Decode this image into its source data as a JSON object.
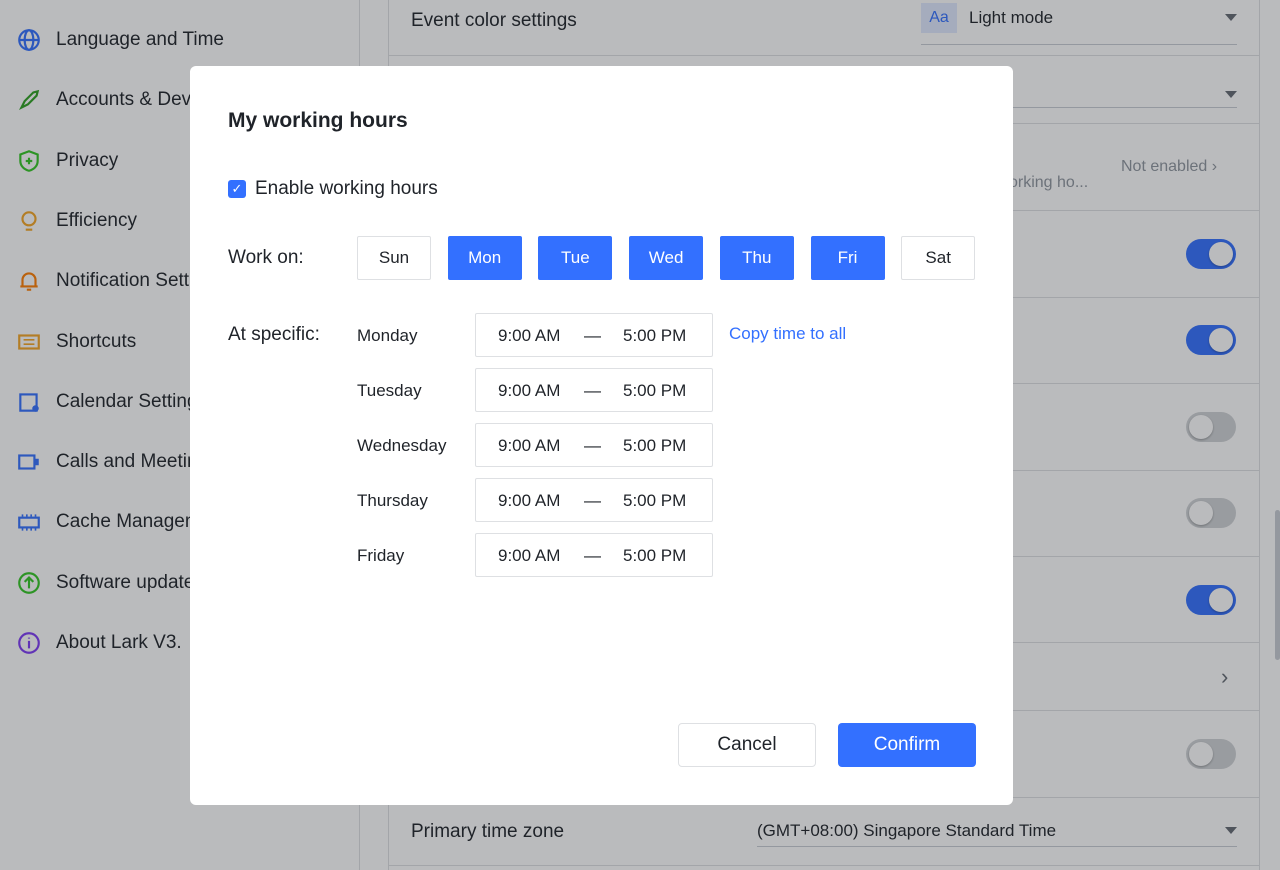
{
  "sidebar": {
    "items": [
      {
        "label": "Language and Time",
        "icon": "globe-icon",
        "color": "#3370ff"
      },
      {
        "label": "Accounts & Devices",
        "icon": "rocket-icon",
        "color": "#2ea121"
      },
      {
        "label": "Privacy",
        "icon": "shield-icon",
        "color": "#34c724"
      },
      {
        "label": "Efficiency",
        "icon": "lightbulb-icon",
        "color": "#f5a623"
      },
      {
        "label": "Notification Settings",
        "icon": "bell-icon",
        "color": "#ff7d00"
      },
      {
        "label": "Shortcuts",
        "icon": "keyboard-icon",
        "color": "#f5a623"
      },
      {
        "label": "Calendar Settings",
        "icon": "calendar-gear-icon",
        "color": "#3370ff"
      },
      {
        "label": "Calls and Meetings",
        "icon": "video-icon",
        "color": "#3370ff"
      },
      {
        "label": "Cache Management",
        "icon": "chip-icon",
        "color": "#3370ff"
      },
      {
        "label": "Software update",
        "icon": "arrow-up-circle-icon",
        "color": "#34c724"
      },
      {
        "label": "About Lark V3.",
        "icon": "info-icon",
        "color": "#7f3bf5"
      }
    ]
  },
  "settings": {
    "event_color": {
      "label": "Event color settings",
      "badge": "Aa",
      "value": "Light mode"
    },
    "working_hours": {
      "desc": "orking ho...",
      "status": "Not enabled"
    },
    "toggles": [
      true,
      true,
      false,
      false,
      true,
      null,
      false
    ],
    "primary_tz": {
      "label": "Primary time zone",
      "value": "(GMT+08:00) Singapore Standard Time"
    }
  },
  "modal": {
    "title": "My working hours",
    "enable_label": "Enable working hours",
    "enabled": true,
    "work_on_label": "Work on:",
    "days": [
      {
        "label": "Sun",
        "on": false
      },
      {
        "label": "Mon",
        "on": true
      },
      {
        "label": "Tue",
        "on": true
      },
      {
        "label": "Wed",
        "on": true
      },
      {
        "label": "Thu",
        "on": true
      },
      {
        "label": "Fri",
        "on": true
      },
      {
        "label": "Sat",
        "on": false
      }
    ],
    "at_specific_label": "At specific:",
    "schedule": [
      {
        "day": "Monday",
        "start": "9:00 AM",
        "end": "5:00 PM"
      },
      {
        "day": "Tuesday",
        "start": "9:00 AM",
        "end": "5:00 PM"
      },
      {
        "day": "Wednesday",
        "start": "9:00 AM",
        "end": "5:00 PM"
      },
      {
        "day": "Thursday",
        "start": "9:00 AM",
        "end": "5:00 PM"
      },
      {
        "day": "Friday",
        "start": "9:00 AM",
        "end": "5:00 PM"
      }
    ],
    "separator": "—",
    "copy_label": "Copy time to all",
    "cancel_label": "Cancel",
    "confirm_label": "Confirm"
  }
}
